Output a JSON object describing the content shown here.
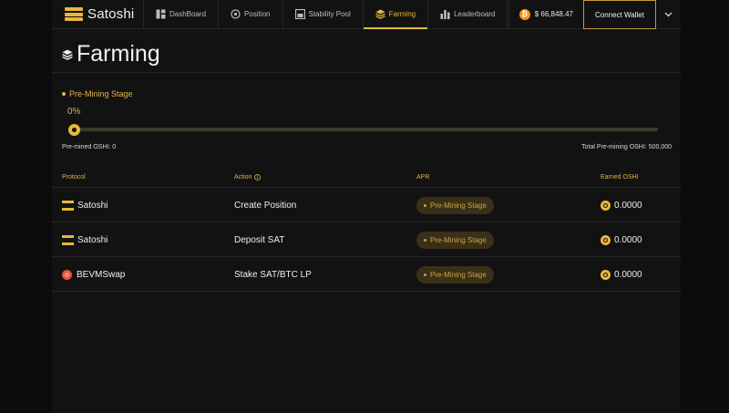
{
  "header": {
    "logo_text": "Satoshi",
    "nav": [
      {
        "label": "DashBoard",
        "icon": "dashboard-icon"
      },
      {
        "label": "Position",
        "icon": "position-icon"
      },
      {
        "label": "Stability Pool",
        "icon": "stability-pool-icon"
      },
      {
        "label": "Farming",
        "icon": "farming-icon",
        "active": true
      },
      {
        "label": "Leaderboard",
        "icon": "leaderboard-icon"
      }
    ],
    "btc_price": "$ 66,848.47",
    "connect_label": "Connect Wallet"
  },
  "page": {
    "title": "Farming"
  },
  "progress": {
    "stage_label": "Pre-Mining Stage",
    "percent_label": "0%",
    "percent": 0,
    "premined_label": "Pre-mined OSHI:  0",
    "total_label": "Total Pre-mining OSHI:  500,000"
  },
  "table": {
    "headers": [
      "Protocol",
      "Action",
      "APR",
      "Earned OSHI"
    ],
    "rows": [
      {
        "protocol": "Satoshi",
        "protocol_icon": "satoshi-icon",
        "action": "Create Position",
        "apr": "Pre-Mining Stage",
        "earned": "0.0000"
      },
      {
        "protocol": "Satoshi",
        "protocol_icon": "satoshi-icon",
        "action": "Deposit SAT",
        "apr": "Pre-Mining Stage",
        "earned": "0.0000"
      },
      {
        "protocol": "BEVMSwap",
        "protocol_icon": "bevmswap-icon",
        "action": "Stake SAT/BTC LP",
        "apr": "Pre-Mining Stage",
        "earned": "0.0000"
      }
    ]
  },
  "colors": {
    "accent": "#e8b83a",
    "background": "#121212",
    "bitcoin": "#f7931a"
  }
}
